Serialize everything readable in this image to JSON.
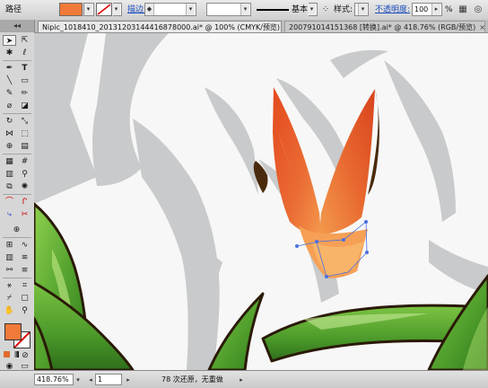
{
  "control_bar": {
    "object_type": "路径",
    "fill_color": "#f07a3a",
    "stroke_label": "描边:",
    "opacity_label": "不透明度:",
    "opacity_value": "100",
    "percent": "%",
    "style_label": "样式:",
    "brush_label": "基本"
  },
  "tabs": [
    {
      "label": "Nipic_1018410_20131203144416878000.ai* @ 100% (CMYK/预览)",
      "close": "×",
      "active": true
    },
    {
      "label": "200791014151368 [转换].ai* @ 418.76% (RGB/预览)",
      "close": "×",
      "active": false
    }
  ],
  "status_bar": {
    "zoom": "418.76%",
    "artboard": "1",
    "message": "78 次还原，无重做"
  },
  "colors": {
    "canvas_bg": "#f7f7f7",
    "shadow": "#c8cacb",
    "petal_dark": "#d5532a",
    "petal_light": "#f59a50",
    "leaf": "#59a233",
    "outline": "#3a2208",
    "selection": "#4b6fe0"
  },
  "icons": {
    "selection_tool": "arrow-icon",
    "direct_selection_tool": "hollow-arrow-icon",
    "pen_tool": "pen-icon",
    "type_tool": "type-icon",
    "zoom_tool": "magnifier-icon",
    "hand_tool": "hand-icon"
  }
}
